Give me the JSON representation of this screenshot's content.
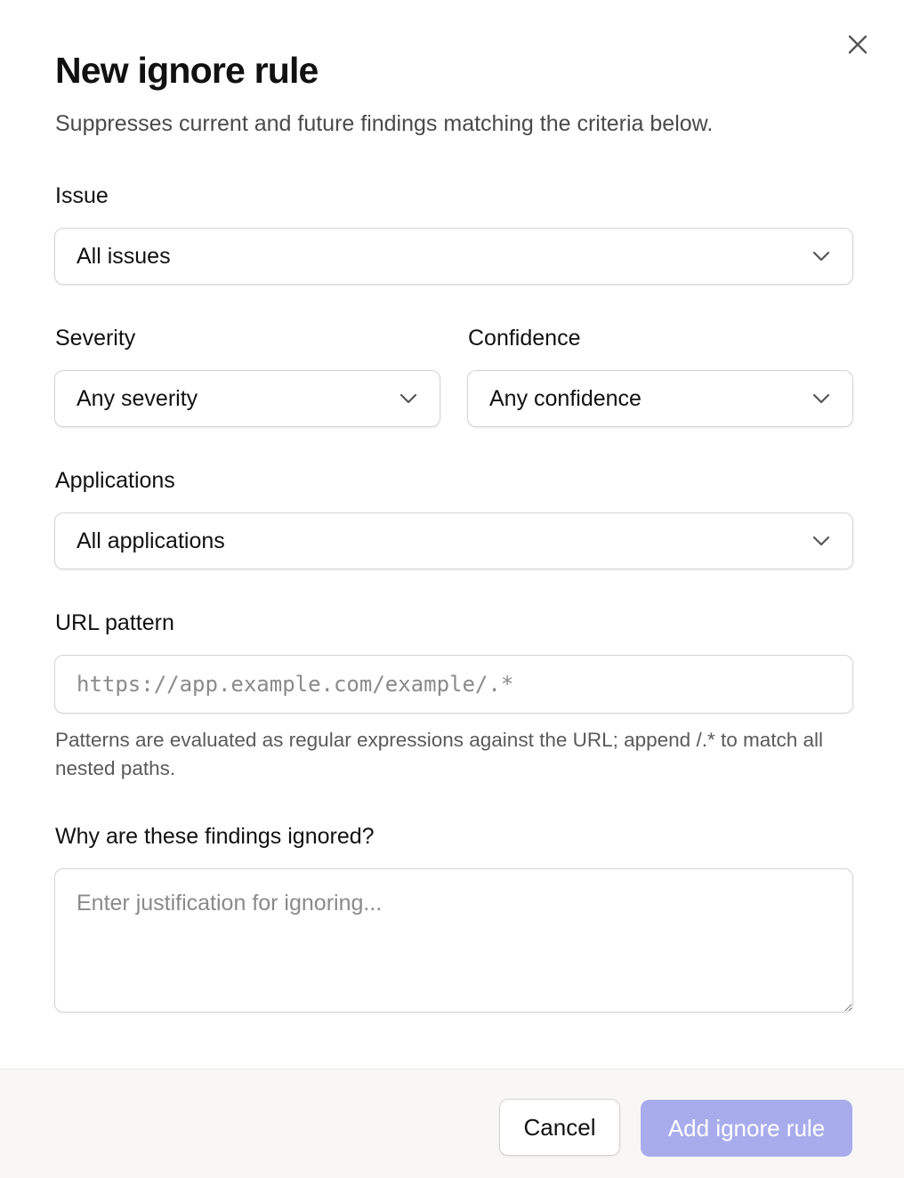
{
  "dialog": {
    "title": "New ignore rule",
    "subtitle": "Suppresses current and future findings matching the criteria below.",
    "close_icon": "close-icon"
  },
  "fields": {
    "issue": {
      "label": "Issue",
      "value": "All issues"
    },
    "severity": {
      "label": "Severity",
      "value": "Any severity"
    },
    "confidence": {
      "label": "Confidence",
      "value": "Any confidence"
    },
    "applications": {
      "label": "Applications",
      "value": "All applications"
    },
    "url_pattern": {
      "label": "URL pattern",
      "value": "",
      "placeholder": "https://app.example.com/example/.*",
      "help": "Patterns are evaluated as regular expressions against the URL; append /.* to match all nested paths."
    },
    "justification": {
      "label": "Why are these findings ignored?",
      "value": "",
      "placeholder": "Enter justification for ignoring..."
    }
  },
  "footer": {
    "cancel_label": "Cancel",
    "submit_label": "Add ignore rule",
    "submit_enabled": false
  },
  "colors": {
    "primary_disabled": "#a8acec",
    "footer_bg": "#f8f7f5",
    "border": "#d4d4d4"
  }
}
